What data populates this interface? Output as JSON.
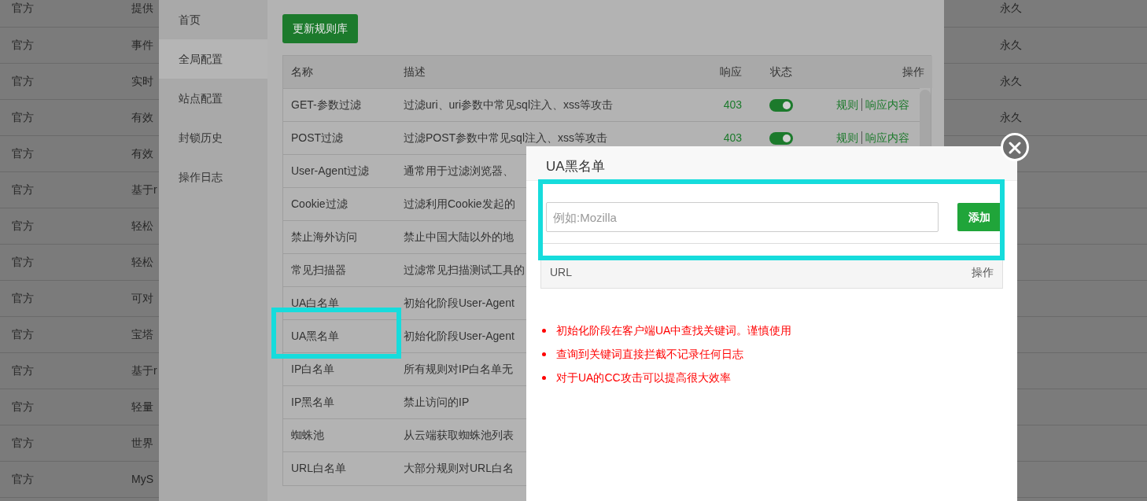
{
  "background_list": {
    "rows": [
      {
        "source": "官方",
        "description": "提供",
        "term": "永久"
      },
      {
        "source": "官方",
        "description": "事件",
        "term": "永久"
      },
      {
        "source": "官方",
        "description": "实时",
        "term": "永久"
      },
      {
        "source": "官方",
        "description": "有效",
        "term": "永久"
      },
      {
        "source": "官方",
        "description": "有效"
      },
      {
        "source": "官方",
        "description": "基于r"
      },
      {
        "source": "官方",
        "description": "轻松"
      },
      {
        "source": "官方",
        "description": "轻松"
      },
      {
        "source": "官方",
        "description": "可对"
      },
      {
        "source": "官方",
        "description": "宝塔"
      },
      {
        "source": "官方",
        "description": "基于r"
      },
      {
        "source": "官方",
        "description": "轻量"
      },
      {
        "source": "官方",
        "description": "世界"
      },
      {
        "source": "官方",
        "description": "MyS"
      }
    ]
  },
  "plugin": {
    "sidebar": [
      {
        "label": "首页",
        "selected": false
      },
      {
        "label": "全局配置",
        "selected": true
      },
      {
        "label": "站点配置",
        "selected": false
      },
      {
        "label": "封锁历史",
        "selected": false
      },
      {
        "label": "操作日志",
        "selected": false
      }
    ],
    "update_button": "更新规则库",
    "rules_table": {
      "columns": [
        "名称",
        "描述",
        "响应",
        "状态",
        "操作"
      ],
      "rows": [
        {
          "name": "GET-参数过滤",
          "description": "过滤uri、uri参数中常见sql注入、xss等攻击",
          "response": "403",
          "on": true,
          "actions": [
            "规则",
            "响应内容"
          ],
          "highlighted": false
        },
        {
          "name": "POST过滤",
          "description": "过滤POST参数中常见sql注入、xss等攻击",
          "response": "403",
          "on": true,
          "actions": [
            "规则",
            "响应内容"
          ],
          "highlighted": false
        },
        {
          "name": "User-Agent过滤",
          "description": "通常用于过滤浏览器、",
          "highlighted": false
        },
        {
          "name": "Cookie过滤",
          "description": "过滤利用Cookie发起的",
          "highlighted": false
        },
        {
          "name": "禁止海外访问",
          "description": "禁止中国大陆以外的地",
          "highlighted": false
        },
        {
          "name": "常见扫描器",
          "description": "过滤常见扫描测试工具的",
          "highlighted": false
        },
        {
          "name": "UA白名单",
          "description": "初始化阶段User-Agent",
          "highlighted": false
        },
        {
          "name": "UA黑名单",
          "description": "初始化阶段User-Agent",
          "highlighted": true
        },
        {
          "name": "IP白名单",
          "description": "所有规则对IP白名单无",
          "highlighted": false
        },
        {
          "name": "IP黑名单",
          "description": "禁止访问的IP",
          "highlighted": false
        },
        {
          "name": "蜘蛛池",
          "description": "从云端获取蜘蛛池列表",
          "highlighted": false
        },
        {
          "name": "URL白名单",
          "description": "大部分规则对URL白名",
          "highlighted": false
        }
      ]
    }
  },
  "dialog": {
    "title": "UA黑名单",
    "input": {
      "placeholder": "例如:Mozilla"
    },
    "add_button": "添加",
    "form_highlighted": true,
    "list_columns": [
      "URL",
      "操作"
    ],
    "notes": [
      "初始化阶段在客户端UA中查找关键词。谨慎使用",
      "查询到关键词直接拦截不记录任何日志",
      "对于UA的CC攻击可以提高很大效率"
    ]
  }
}
